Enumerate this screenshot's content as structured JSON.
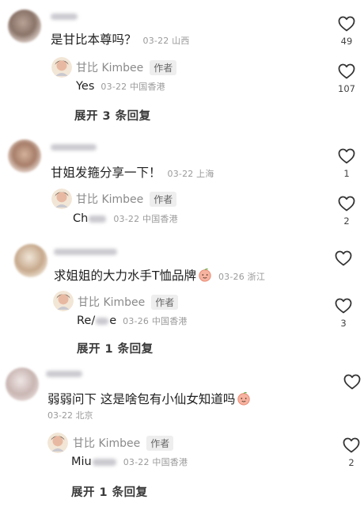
{
  "threads": [
    {
      "comment": {
        "text": "是甘比本尊吗？",
        "meta": "03-22 山西",
        "likes": "49"
      },
      "reply": {
        "name": "甘比 Kimbee",
        "badge": "作者",
        "text": "Yes",
        "meta": "03-22 中国香港",
        "likes": "107"
      },
      "expand": "展开 3 条回复"
    },
    {
      "comment": {
        "text": "甘姐发箍分享一下！",
        "meta": "03-22 上海",
        "likes": "1"
      },
      "reply": {
        "name": "甘比 Kimbee",
        "badge": "作者",
        "text": "Ch",
        "meta": "03-22 中国香港",
        "likes": "2"
      }
    },
    {
      "comment": {
        "text": "求姐姐的大力水手T恤品牌",
        "meta": "03-26 浙江",
        "likes": ""
      },
      "reply": {
        "name": "甘比 Kimbee",
        "badge": "作者",
        "text": "Re/",
        "text_after": "e",
        "meta": "03-26 中国香港",
        "likes": "3"
      },
      "expand": "展开 1 条回复"
    },
    {
      "comment": {
        "text": "弱弱问下 这是啥包有小仙女知道吗",
        "meta": "03-22 北京",
        "likes": ""
      },
      "reply": {
        "name": "甘比 Kimbee",
        "badge": "作者",
        "text": "Miu",
        "meta": "03-22 中国香港",
        "likes": "2"
      },
      "expand": "展开 1 条回复"
    }
  ],
  "colors": {
    "text": "#1f1f1f",
    "meta": "#9a9a9a",
    "heart_outline": "#333333",
    "author_badge_bg": "#eeeeee"
  },
  "icons": {
    "like": "heart-outline-icon",
    "emoji": "peach-emoji-icon"
  }
}
